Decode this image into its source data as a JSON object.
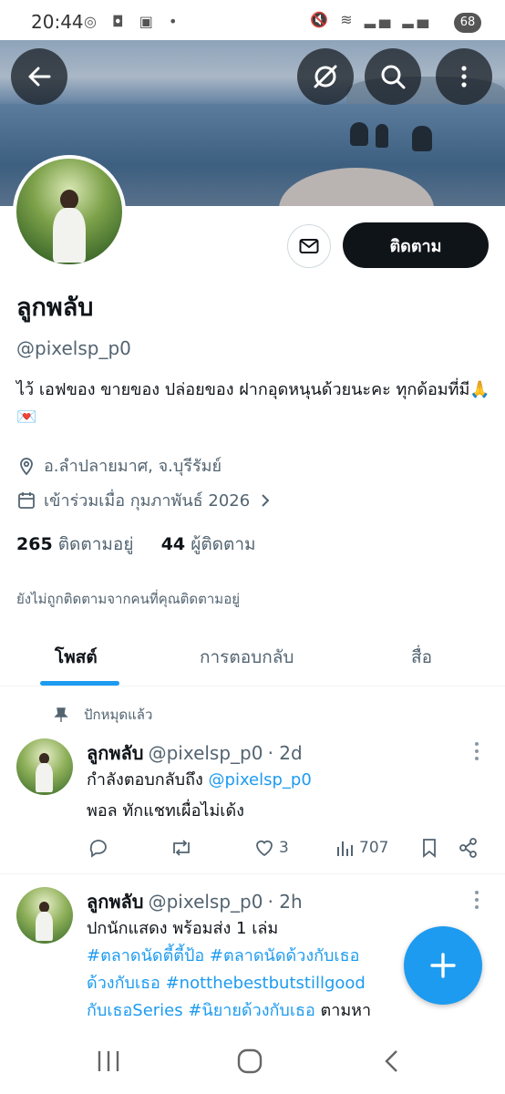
{
  "status_bar": {
    "time": "20:44",
    "battery": "68",
    "left_icons": "◎ ◘ ▣ •",
    "right_icons": "🔇 ≋ ▂▄ ▂▄"
  },
  "profile": {
    "name": "ลูกพลับ",
    "handle": "@pixelsp_p0",
    "bio": "ไว้ เอฟของ ขายของ ปล่อยของ ฝากอุดหนุนด้วยนะคะ ทุกด้อมที่มี🙏💌",
    "location": "อ.ลำปลายมาศ, จ.บุรีรัมย์",
    "joined": "เข้าร่วมเมื่อ กุมภาพันธ์ 2026",
    "following_count": "265",
    "following_label": "ติดตามอยู่",
    "followers_count": "44",
    "followers_label": "ผู้ติดตาม",
    "not_followed_note": "ยังไม่ถูกติดตามจากคนที่คุณติดตามอยู่",
    "follow_button": "ติดตาม"
  },
  "tabs": [
    "โพสต์",
    "การตอบกลับ",
    "สื่อ"
  ],
  "pinned_label": "ปักหมุดแล้ว",
  "posts": [
    {
      "name": "ลูกพลับ",
      "handle": "@pixelsp_p0",
      "time": "· 2d",
      "reply_to_prefix": "กำลังตอบกลับถึง ",
      "reply_to": "@pixelsp_p0",
      "text": "พอล ทักแชทเผื่อไม่เด้ง",
      "likes": "3",
      "views": "707"
    },
    {
      "name": "ลูกพลับ",
      "handle": "@pixelsp_p0",
      "time": "· 2h",
      "line1": "ปกนักแสดง พร้อมส่ง 1 เล่ม",
      "line2": "#ตลาดนัดตี้ตี้ป้อ #ตลาดนัดด้วงกับเธอ",
      "line3": "ด้วงกับเธอ #notthebestbutstillgood",
      "line4_link": "กับเธอSeries #นิยายด้วงกับเธอ",
      "line4_rest": " ตามหา"
    }
  ]
}
